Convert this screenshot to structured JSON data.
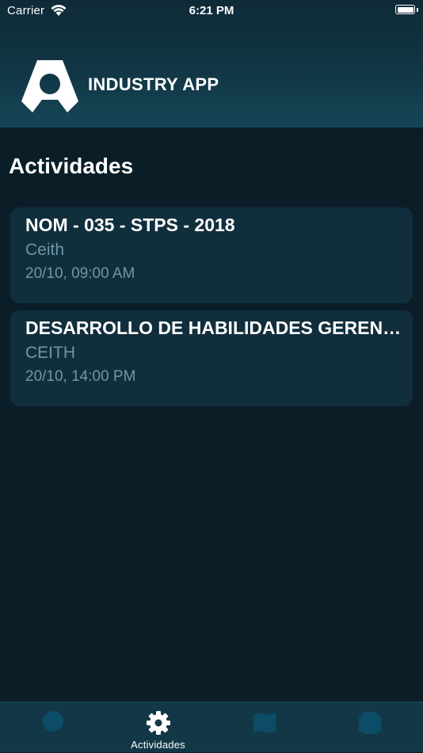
{
  "status_bar": {
    "carrier": "Carrier",
    "time": "6:21 PM"
  },
  "header": {
    "brand_name": "INDUSTRY APP"
  },
  "page": {
    "title": "Actividades"
  },
  "activities": [
    {
      "title": "NOM - 035 - STPS - 2018",
      "organizer": "Ceith",
      "datetime": "20/10, 09:00 AM"
    },
    {
      "title": "DESARROLLO DE HABILIDADES GERENCIALES",
      "organizer": "CEITH",
      "datetime": "20/10, 14:00 PM"
    }
  ],
  "tabbar": {
    "tabs": [
      {
        "icon": "circle-icon",
        "label": "",
        "active": false
      },
      {
        "icon": "gear-icon",
        "label": "Actividades",
        "active": true
      },
      {
        "icon": "map-icon",
        "label": "",
        "active": false
      },
      {
        "icon": "badge-icon",
        "label": "",
        "active": false
      }
    ]
  },
  "colors": {
    "background": "#0b1e28",
    "header_gradient_top": "#0f2a37",
    "header_gradient_bottom": "#154656",
    "card": "#112e3d",
    "secondary_text": "#6f96a7",
    "tabbar": "#123848",
    "inactive_icon": "#0d4c66"
  }
}
